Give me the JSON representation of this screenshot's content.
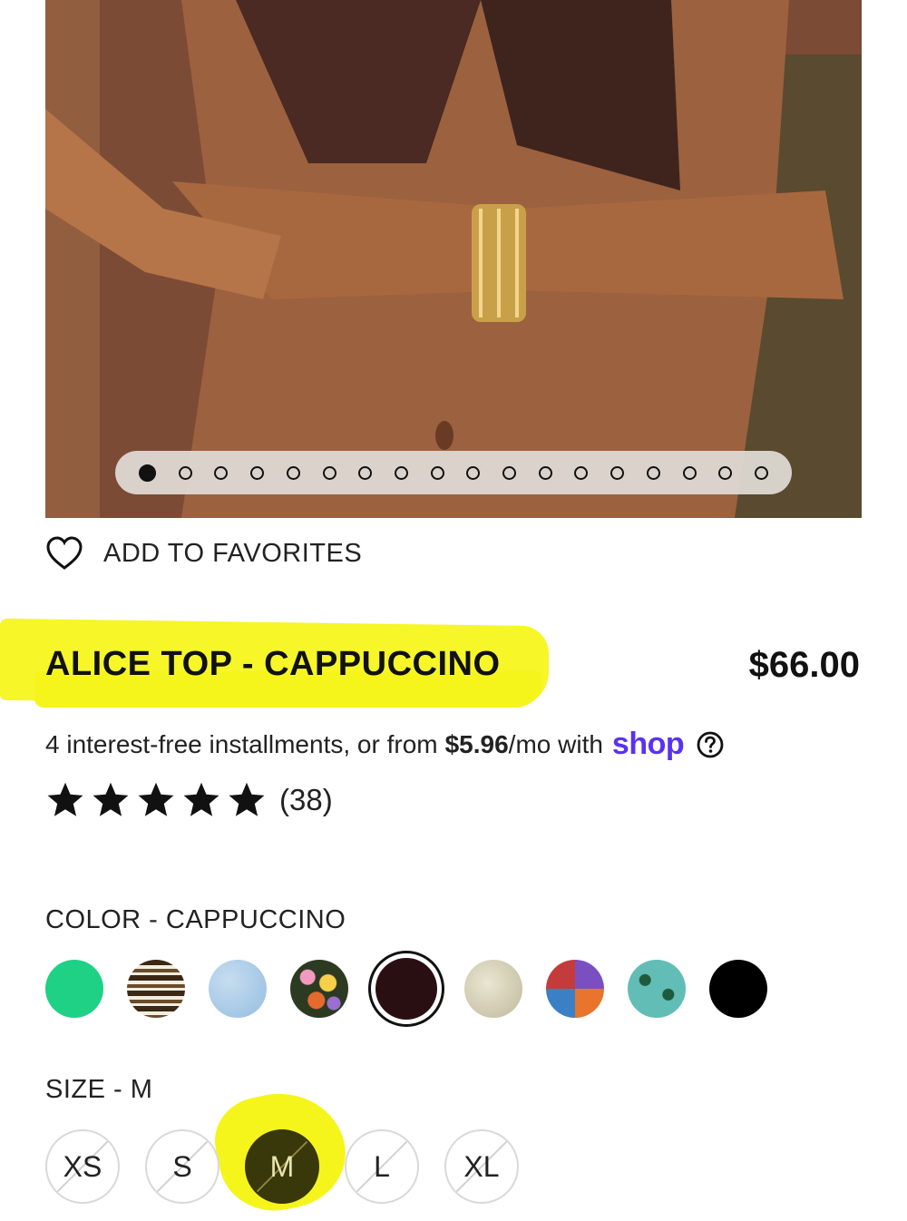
{
  "favorites": {
    "label": "ADD TO FAVORITES"
  },
  "product": {
    "title": "ALICE TOP - CAPPUCCINO",
    "price": "$66.00"
  },
  "installments": {
    "prefix": "4 interest-free installments, or from",
    "amount": "$5.96",
    "suffix": "/mo with",
    "provider": "shop"
  },
  "rating": {
    "stars": 5,
    "count": "(38)"
  },
  "color": {
    "label": "COLOR - CAPPUCCINO",
    "swatch_colors": [
      "#1fd184",
      "stripes",
      "#a9cdea",
      "floral",
      "#2a0f12",
      "#d8d4bf",
      "patchwork",
      "#5fb9b4",
      "#000000"
    ]
  },
  "size": {
    "label": "SIZE - M",
    "options": [
      "XS",
      "S",
      "M",
      "L",
      "XL"
    ],
    "selected": "M"
  },
  "gallery": {
    "total": 18,
    "active": 1
  },
  "colors": {
    "shop_brand": "#5a31f4",
    "highlight": "#f5f51c"
  }
}
